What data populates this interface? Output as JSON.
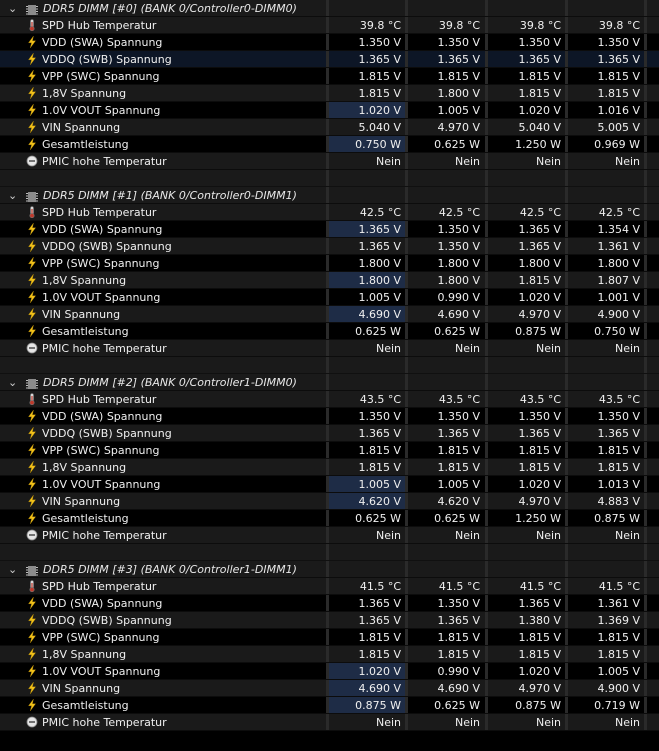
{
  "groups": [
    {
      "title": "DDR5 DIMM [#0] (BANK 0/Controller0-DIMM0)",
      "rows": [
        {
          "icon": "thermometer-icon",
          "label": "SPD Hub Temperatur",
          "values": [
            "39.8 °C",
            "39.8 °C",
            "39.8 °C",
            "39.8 °C"
          ]
        },
        {
          "icon": "lightning-icon",
          "label": "VDD (SWA) Spannung",
          "values": [
            "1.350 V",
            "1.350 V",
            "1.350 V",
            "1.350 V"
          ]
        },
        {
          "icon": "lightning-icon",
          "label": "VDDQ (SWB) Spannung",
          "values": [
            "1.365 V",
            "1.365 V",
            "1.365 V",
            "1.365 V"
          ]
        },
        {
          "icon": "lightning-icon",
          "label": "VPP (SWC) Spannung",
          "values": [
            "1.815 V",
            "1.815 V",
            "1.815 V",
            "1.815 V"
          ]
        },
        {
          "icon": "lightning-icon",
          "label": "1,8V Spannung",
          "values": [
            "1.815 V",
            "1.800 V",
            "1.815 V",
            "1.815 V"
          ]
        },
        {
          "icon": "lightning-icon",
          "label": "1.0V VOUT Spannung",
          "values": [
            "1.020 V",
            "1.005 V",
            "1.020 V",
            "1.016 V"
          ]
        },
        {
          "icon": "lightning-icon",
          "label": "VIN Spannung",
          "values": [
            "5.040 V",
            "4.970 V",
            "5.040 V",
            "5.005 V"
          ]
        },
        {
          "icon": "lightning-icon",
          "label": "Gesamtleistung",
          "values": [
            "0.750 W",
            "0.625 W",
            "1.250 W",
            "0.969 W"
          ]
        },
        {
          "icon": "status-circle-icon",
          "label": "PMIC hohe Temperatur",
          "values": [
            "Nein",
            "Nein",
            "Nein",
            "Nein"
          ]
        }
      ]
    },
    {
      "title": "DDR5 DIMM [#1] (BANK 0/Controller0-DIMM1)",
      "rows": [
        {
          "icon": "thermometer-icon",
          "label": "SPD Hub Temperatur",
          "values": [
            "42.5 °C",
            "42.5 °C",
            "42.5 °C",
            "42.5 °C"
          ]
        },
        {
          "icon": "lightning-icon",
          "label": "VDD (SWA) Spannung",
          "values": [
            "1.365 V",
            "1.350 V",
            "1.365 V",
            "1.354 V"
          ]
        },
        {
          "icon": "lightning-icon",
          "label": "VDDQ (SWB) Spannung",
          "values": [
            "1.365 V",
            "1.350 V",
            "1.365 V",
            "1.361 V"
          ]
        },
        {
          "icon": "lightning-icon",
          "label": "VPP (SWC) Spannung",
          "values": [
            "1.800 V",
            "1.800 V",
            "1.800 V",
            "1.800 V"
          ]
        },
        {
          "icon": "lightning-icon",
          "label": "1,8V Spannung",
          "values": [
            "1.800 V",
            "1.800 V",
            "1.815 V",
            "1.807 V"
          ]
        },
        {
          "icon": "lightning-icon",
          "label": "1.0V VOUT Spannung",
          "values": [
            "1.005 V",
            "0.990 V",
            "1.020 V",
            "1.001 V"
          ]
        },
        {
          "icon": "lightning-icon",
          "label": "VIN Spannung",
          "values": [
            "4.690 V",
            "4.690 V",
            "4.970 V",
            "4.900 V"
          ]
        },
        {
          "icon": "lightning-icon",
          "label": "Gesamtleistung",
          "values": [
            "0.625 W",
            "0.625 W",
            "0.875 W",
            "0.750 W"
          ]
        },
        {
          "icon": "status-circle-icon",
          "label": "PMIC hohe Temperatur",
          "values": [
            "Nein",
            "Nein",
            "Nein",
            "Nein"
          ]
        }
      ]
    },
    {
      "title": "DDR5 DIMM [#2] (BANK 0/Controller1-DIMM0)",
      "rows": [
        {
          "icon": "thermometer-icon",
          "label": "SPD Hub Temperatur",
          "values": [
            "43.5 °C",
            "43.5 °C",
            "43.5 °C",
            "43.5 °C"
          ]
        },
        {
          "icon": "lightning-icon",
          "label": "VDD (SWA) Spannung",
          "values": [
            "1.350 V",
            "1.350 V",
            "1.350 V",
            "1.350 V"
          ]
        },
        {
          "icon": "lightning-icon",
          "label": "VDDQ (SWB) Spannung",
          "values": [
            "1.365 V",
            "1.365 V",
            "1.365 V",
            "1.365 V"
          ]
        },
        {
          "icon": "lightning-icon",
          "label": "VPP (SWC) Spannung",
          "values": [
            "1.815 V",
            "1.815 V",
            "1.815 V",
            "1.815 V"
          ]
        },
        {
          "icon": "lightning-icon",
          "label": "1,8V Spannung",
          "values": [
            "1.815 V",
            "1.815 V",
            "1.815 V",
            "1.815 V"
          ]
        },
        {
          "icon": "lightning-icon",
          "label": "1.0V VOUT Spannung",
          "values": [
            "1.005 V",
            "1.005 V",
            "1.020 V",
            "1.013 V"
          ]
        },
        {
          "icon": "lightning-icon",
          "label": "VIN Spannung",
          "values": [
            "4.620 V",
            "4.620 V",
            "4.970 V",
            "4.883 V"
          ]
        },
        {
          "icon": "lightning-icon",
          "label": "Gesamtleistung",
          "values": [
            "0.625 W",
            "0.625 W",
            "1.250 W",
            "0.875 W"
          ]
        },
        {
          "icon": "status-circle-icon",
          "label": "PMIC hohe Temperatur",
          "values": [
            "Nein",
            "Nein",
            "Nein",
            "Nein"
          ]
        }
      ]
    },
    {
      "title": "DDR5 DIMM [#3] (BANK 0/Controller1-DIMM1)",
      "rows": [
        {
          "icon": "thermometer-icon",
          "label": "SPD Hub Temperatur",
          "values": [
            "41.5 °C",
            "41.5 °C",
            "41.5 °C",
            "41.5 °C"
          ]
        },
        {
          "icon": "lightning-icon",
          "label": "VDD (SWA) Spannung",
          "values": [
            "1.365 V",
            "1.350 V",
            "1.365 V",
            "1.361 V"
          ]
        },
        {
          "icon": "lightning-icon",
          "label": "VDDQ (SWB) Spannung",
          "values": [
            "1.365 V",
            "1.365 V",
            "1.380 V",
            "1.369 V"
          ]
        },
        {
          "icon": "lightning-icon",
          "label": "VPP (SWC) Spannung",
          "values": [
            "1.815 V",
            "1.815 V",
            "1.815 V",
            "1.815 V"
          ]
        },
        {
          "icon": "lightning-icon",
          "label": "1,8V Spannung",
          "values": [
            "1.815 V",
            "1.815 V",
            "1.815 V",
            "1.815 V"
          ]
        },
        {
          "icon": "lightning-icon",
          "label": "1.0V VOUT Spannung",
          "values": [
            "1.020 V",
            "0.990 V",
            "1.020 V",
            "1.005 V"
          ]
        },
        {
          "icon": "lightning-icon",
          "label": "VIN Spannung",
          "values": [
            "4.690 V",
            "4.690 V",
            "4.970 V",
            "4.900 V"
          ]
        },
        {
          "icon": "lightning-icon",
          "label": "Gesamtleistung",
          "values": [
            "0.875 W",
            "0.625 W",
            "0.875 W",
            "0.719 W"
          ]
        },
        {
          "icon": "status-circle-icon",
          "label": "PMIC hohe Temperatur",
          "values": [
            "Nein",
            "Nein",
            "Nein",
            "Nein"
          ]
        }
      ]
    }
  ],
  "colors": {
    "background": "#000000",
    "row": "#1a1a1a",
    "highlight": "#1e2c46",
    "selected_row": "#0d1626",
    "lightning": "#f2c21b",
    "text": "#f0f0f0"
  }
}
